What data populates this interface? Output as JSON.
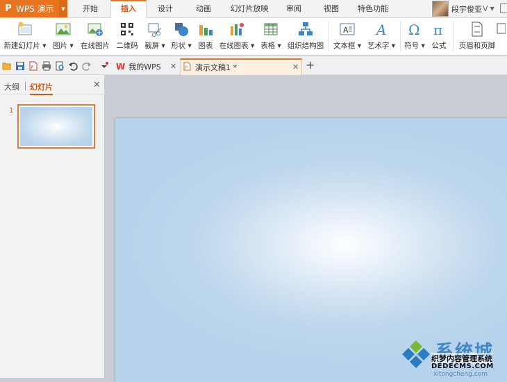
{
  "app": {
    "logo": "P",
    "name": "WPS 演示",
    "accent": "#e8741f"
  },
  "tabs": [
    {
      "label": "开始"
    },
    {
      "label": "插入"
    },
    {
      "label": "设计"
    },
    {
      "label": "动画"
    },
    {
      "label": "幻灯片放映"
    },
    {
      "label": "审阅"
    },
    {
      "label": "视图"
    },
    {
      "label": "特色功能"
    }
  ],
  "active_tab": "插入",
  "user": {
    "name": "段宇俊亚",
    "badge": "V"
  },
  "ribbon": {
    "items": [
      {
        "label": "新建幻灯片",
        "icon": "new-slide-icon",
        "dropdown": true
      },
      {
        "label": "图片",
        "icon": "picture-icon",
        "dropdown": true
      },
      {
        "label": "在线图片",
        "icon": "online-picture-icon",
        "dropdown": false
      },
      {
        "label": "二维码",
        "icon": "qrcode-icon",
        "dropdown": false
      },
      {
        "label": "截屏",
        "icon": "screenshot-icon",
        "dropdown": true
      },
      {
        "label": "形状",
        "icon": "shapes-icon",
        "dropdown": true
      },
      {
        "label": "图表",
        "icon": "chart-icon",
        "dropdown": false
      },
      {
        "label": "在线图表",
        "icon": "online-chart-icon",
        "dropdown": true
      },
      {
        "label": "表格",
        "icon": "table-icon",
        "dropdown": true
      },
      {
        "label": "组织结构图",
        "icon": "org-chart-icon",
        "dropdown": false
      },
      {
        "label": "文本框",
        "icon": "textbox-icon",
        "dropdown": true
      },
      {
        "label": "艺术字",
        "icon": "wordart-icon",
        "dropdown": true
      },
      {
        "label": "符号",
        "icon": "symbol-icon",
        "dropdown": true
      },
      {
        "label": "公式",
        "icon": "formula-icon",
        "dropdown": false
      },
      {
        "label": "页眉和页脚",
        "icon": "header-footer-icon",
        "dropdown": false
      }
    ]
  },
  "documents": [
    {
      "title": "我的WPS"
    },
    {
      "title": "演示文稿1 *"
    }
  ],
  "left_panel": {
    "tab_outline": "大纲",
    "tab_slides": "幻灯片",
    "slide_numbers": [
      "1"
    ]
  },
  "watermark": {
    "big_text": "系统城",
    "cn_text": "织梦内容管理系统",
    "en_text": "DEDECMS.COM",
    "url": "xitongcheng.com"
  }
}
